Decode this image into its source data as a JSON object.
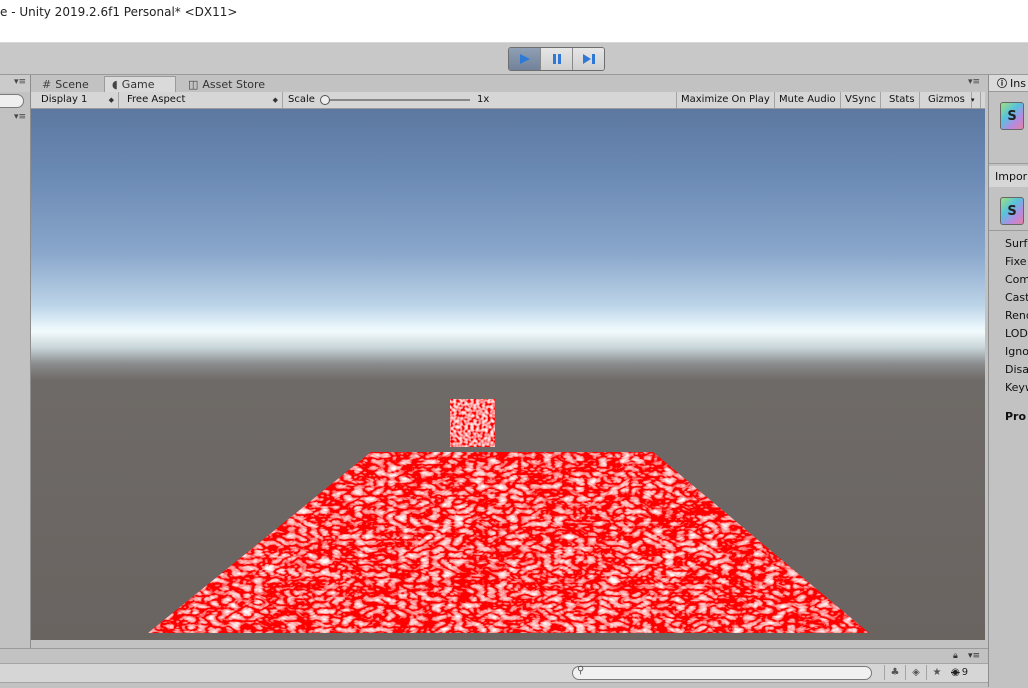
{
  "window": {
    "title": "e - Unity 2019.2.6f1 Personal* <DX11>"
  },
  "toolbar": {
    "play_icon": "play-icon",
    "pause_icon": "pause-icon",
    "step_icon": "step-icon"
  },
  "tabs": [
    {
      "label": "Scene",
      "icon": "grid-icon"
    },
    {
      "label": "Game",
      "icon": "pacman-icon"
    },
    {
      "label": "Asset Store",
      "icon": "bag-icon"
    }
  ],
  "game_toolbar": {
    "display": "Display 1",
    "aspect": "Free Aspect",
    "scale_label": "Scale",
    "scale_value": "1x",
    "maximize": "Maximize On Play",
    "mute": "Mute Audio",
    "vsync": "VSync",
    "stats": "Stats",
    "gizmos": "Gizmos"
  },
  "inspector": {
    "tab_label": "Ins",
    "imported_label": "Impor",
    "shader_letter": "S",
    "properties": [
      "Surf",
      "Fixe",
      "Com",
      "Cast",
      "Rend",
      "LOD",
      "Igno",
      "Disa",
      "Keyw"
    ],
    "section": "Pro"
  },
  "bottom": {
    "hidden_count": "9"
  },
  "colors": {
    "play_active": "#2f79d6",
    "texture_red": "#ff0000"
  }
}
